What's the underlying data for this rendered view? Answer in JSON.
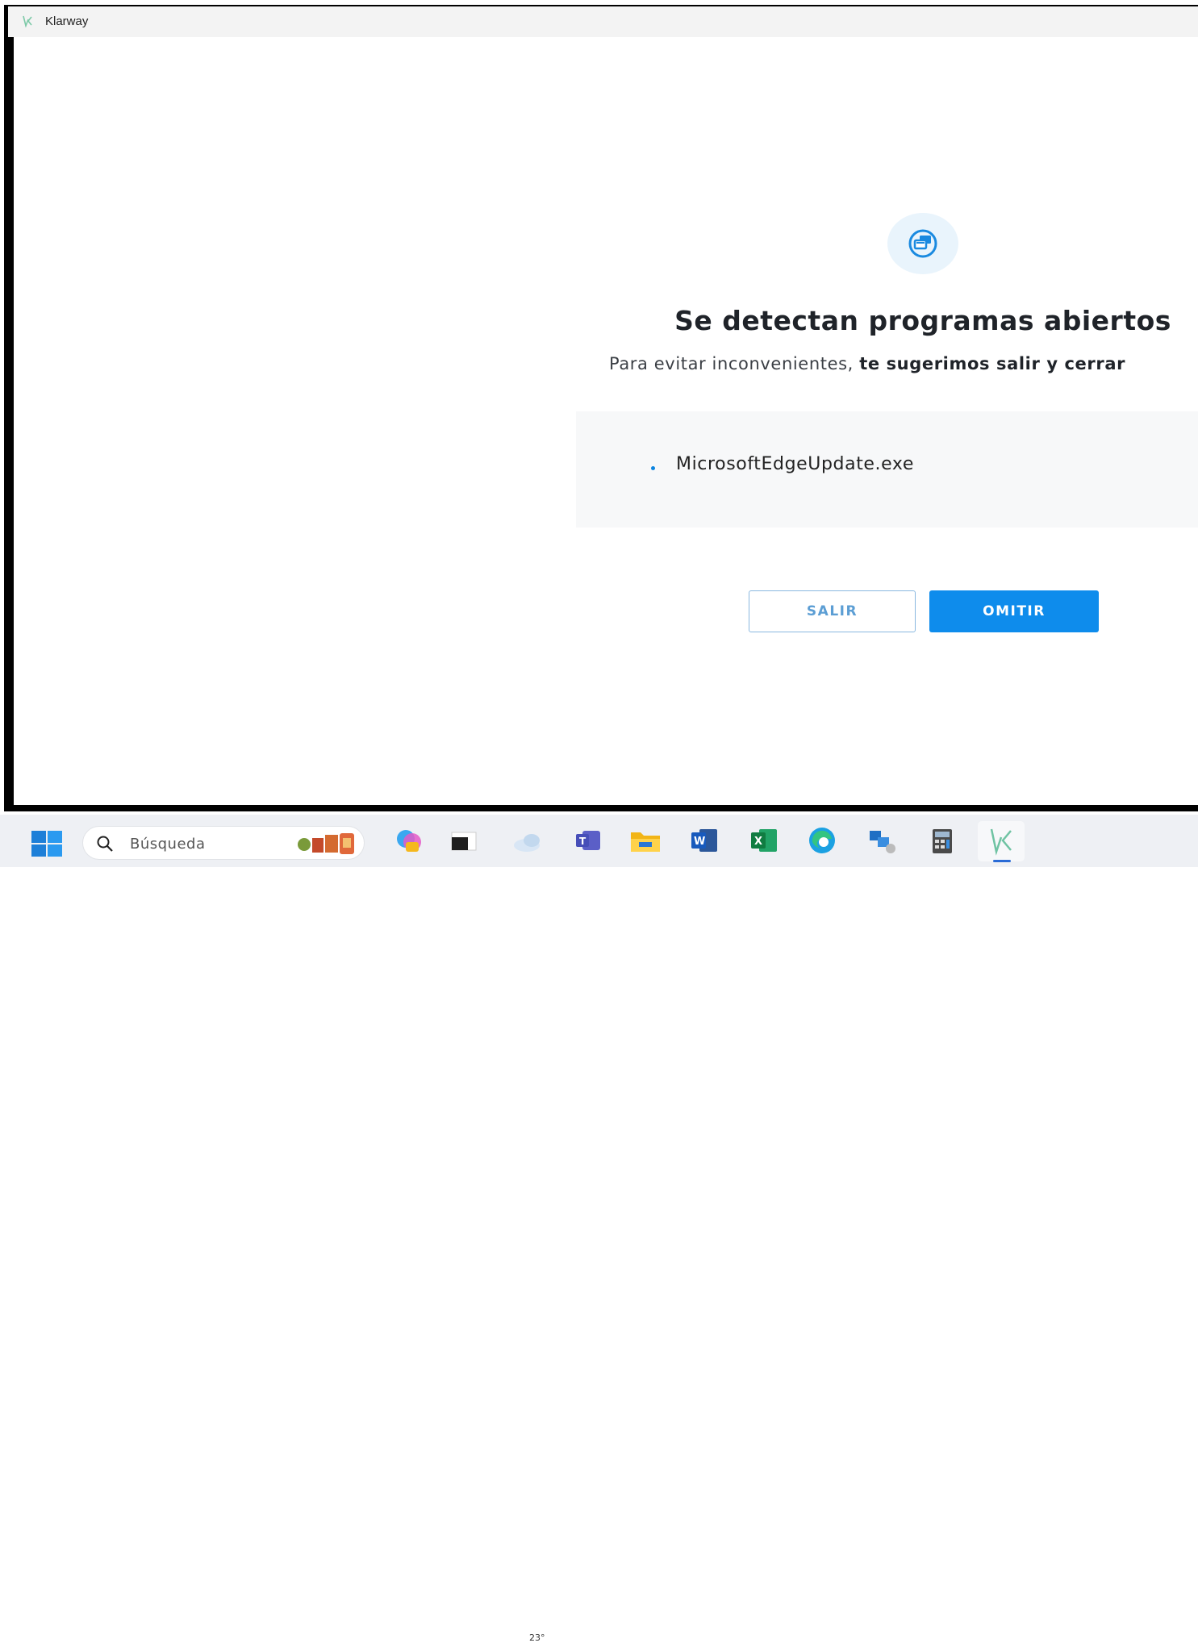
{
  "window": {
    "title": "Klarway"
  },
  "dialog": {
    "title": "Se detectan programas abiertos",
    "subtitle_plain": "Para evitar inconvenientes, ",
    "subtitle_bold": "te sugerimos salir y cerrar",
    "processes": [
      "MicrosoftEdgeUpdate.exe"
    ],
    "buttons": {
      "secondary": "SALIR",
      "primary": "OMITIR"
    }
  },
  "taskbar": {
    "search_placeholder": "Búsqueda",
    "weather_temp": "23°",
    "icons": [
      "start-icon",
      "search-icon",
      "widget-icon",
      "copilot-icon",
      "terminal-icon",
      "weather-icon",
      "teams-icon",
      "file-explorer-icon",
      "word-icon",
      "excel-icon",
      "edge-icon",
      "remote-desktop-icon",
      "calculator-icon",
      "klarway-icon"
    ],
    "active_app": "klarway-icon"
  },
  "colors": {
    "accent": "#0e8cec",
    "accent_light": "#e9f4fc",
    "title_text": "#1f2329",
    "panel_bg": "#f7f8f9"
  }
}
